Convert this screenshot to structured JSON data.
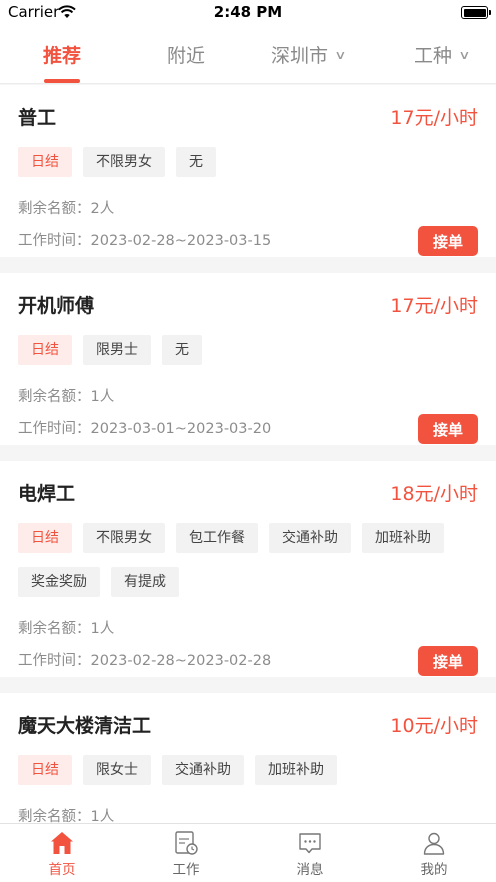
{
  "status_bar": {
    "carrier": "Carrier",
    "time": "2:48 PM"
  },
  "top_tabs": [
    {
      "label": "推荐",
      "active": true
    },
    {
      "label": "附近",
      "active": false
    },
    {
      "label": "深圳市",
      "active": false,
      "dropdown": true
    },
    {
      "label": "工种",
      "active": false,
      "dropdown": true
    }
  ],
  "labels": {
    "quota_prefix": "剩余名额：",
    "time_prefix": "工作时间：",
    "apply": "接单"
  },
  "jobs": [
    {
      "title": "普工",
      "salary": "17元/小时",
      "tags": [
        "日结",
        "不限男女",
        "无"
      ],
      "quota": "2人",
      "period": "2023-02-28~2023-03-15"
    },
    {
      "title": "开机师傅",
      "salary": "17元/小时",
      "tags": [
        "日结",
        "限男士",
        "无"
      ],
      "quota": "1人",
      "period": "2023-03-01~2023-03-20"
    },
    {
      "title": "电焊工",
      "salary": "18元/小时",
      "tags": [
        "日结",
        "不限男女",
        "包工作餐",
        "交通补助",
        "加班补助",
        "奖金奖励",
        "有提成"
      ],
      "quota": "1人",
      "period": "2023-02-28~2023-02-28"
    },
    {
      "title": "魔天大楼清洁工",
      "salary": "10元/小时",
      "tags": [
        "日结",
        "限女士",
        "交通补助",
        "加班补助"
      ],
      "quota": "1人",
      "period": ""
    }
  ],
  "bottom_tabs": [
    {
      "label": "首页",
      "icon": "home-icon",
      "active": true
    },
    {
      "label": "工作",
      "icon": "work-calendar-icon",
      "active": false
    },
    {
      "label": "消息",
      "icon": "message-icon",
      "active": false
    },
    {
      "label": "我的",
      "icon": "person-icon",
      "active": false
    }
  ],
  "colors": {
    "accent": "#f2533f",
    "tag_highlight_bg": "#fdecea",
    "tag_bg": "#f2f2f2"
  }
}
